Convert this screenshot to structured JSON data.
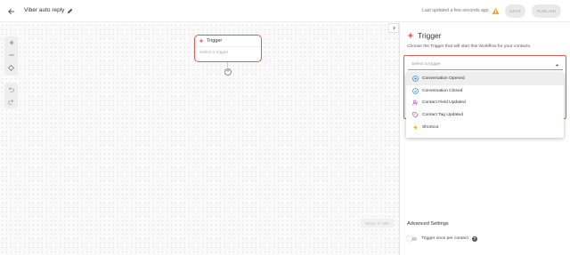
{
  "header": {
    "workflow_name": "Viber auto reply",
    "last_updated": "Last updated a few seconds ago",
    "save_label": "SAVE",
    "publish_label": "PUBLISH",
    "icons": {
      "back": "arrow-left-icon",
      "edit": "pencil-icon",
      "warning": "warning-icon"
    }
  },
  "canvas": {
    "tools": {
      "zoom_in": "plus-icon",
      "zoom_out": "minus-icon",
      "fit": "fit-view-icon",
      "undo": "undo-icon",
      "redo": "redo-icon"
    },
    "node": {
      "title": "Trigger",
      "placeholder": "Select a trigger",
      "icon": "sparkle-icon"
    },
    "add_icon": "+",
    "steps_badge": "Steps: 0 / 100"
  },
  "panel": {
    "collapse_icon": "chevron-right-icon",
    "title": "Trigger",
    "description": "Choose the Trigger that will start this Workflow for your contacts.",
    "select_placeholder": "Select a trigger",
    "options": [
      {
        "label": "Conversation Opened",
        "icon": "chat-bubble-icon",
        "color": "#1e88e5"
      },
      {
        "label": "Conversation Closed",
        "icon": "chat-check-icon",
        "color": "#1e88e5"
      },
      {
        "label": "Contact Field Updated",
        "icon": "contact-field-icon",
        "color": "#ab47bc"
      },
      {
        "label": "Contact Tag Updated",
        "icon": "tag-icon",
        "color": "#ab47bc"
      },
      {
        "label": "Shortcut",
        "icon": "lightning-icon",
        "color": "#ffb300"
      }
    ],
    "advanced_title": "Advanced Settings",
    "toggle_label": "Trigger once per contact",
    "help_icon": "?"
  },
  "colors": {
    "accent_red": "#e05a5a",
    "warning_orange": "#f5a623",
    "disabled_button_bg": "#e9e9e9"
  }
}
